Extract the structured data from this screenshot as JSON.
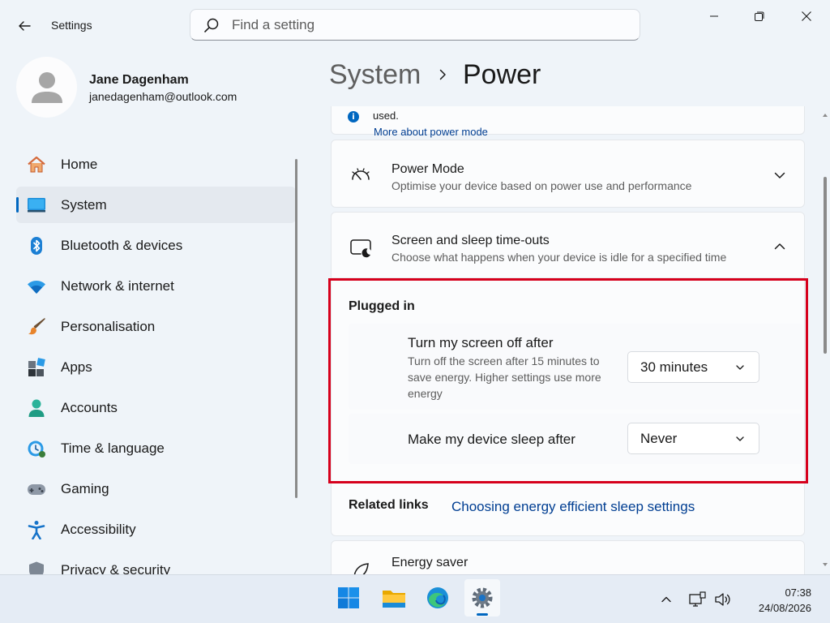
{
  "window": {
    "app_title": "Settings",
    "search_placeholder": "Find a setting"
  },
  "profile": {
    "name": "Jane Dagenham",
    "email": "janedagenham@outlook.com"
  },
  "sidebar": {
    "items": [
      {
        "label": "Home",
        "icon": "home-icon"
      },
      {
        "label": "System",
        "icon": "system-icon",
        "active": true
      },
      {
        "label": "Bluetooth & devices",
        "icon": "bluetooth-icon"
      },
      {
        "label": "Network & internet",
        "icon": "wifi-icon"
      },
      {
        "label": "Personalisation",
        "icon": "brush-icon"
      },
      {
        "label": "Apps",
        "icon": "apps-icon"
      },
      {
        "label": "Accounts",
        "icon": "accounts-icon"
      },
      {
        "label": "Time & language",
        "icon": "clock-globe-icon"
      },
      {
        "label": "Gaming",
        "icon": "gamepad-icon"
      },
      {
        "label": "Accessibility",
        "icon": "accessibility-icon"
      },
      {
        "label": "Privacy & security",
        "icon": "shield-icon"
      }
    ]
  },
  "header": {
    "parent": "System",
    "current": "Power"
  },
  "content": {
    "note_text": "used.",
    "note_link": "More about power mode",
    "power_mode": {
      "title": "Power Mode",
      "description": "Optimise your device based on power use and performance"
    },
    "screen_sleep": {
      "title": "Screen and sleep time-outs",
      "description": "Choose what happens when your device is idle for a specified time",
      "group_title": "Plugged in",
      "screen_off": {
        "title": "Turn my screen off after",
        "description": "Turn off the screen after 15 minutes to save energy. Higher settings use more energy",
        "value": "30 minutes"
      },
      "sleep": {
        "title": "Make my device sleep after",
        "value": "Never"
      },
      "related_label": "Related links",
      "related_link": "Choosing energy efficient sleep settings"
    },
    "energy_saver": {
      "title": "Energy saver"
    }
  },
  "taskbar": {
    "apps": [
      "windows-start-icon",
      "file-explorer-icon",
      "edge-icon",
      "settings-icon"
    ],
    "time": "07:38",
    "date": "24/08/2026"
  },
  "colors": {
    "accent": "#0067c0",
    "highlight": "#d6001c",
    "link": "#003e92"
  }
}
